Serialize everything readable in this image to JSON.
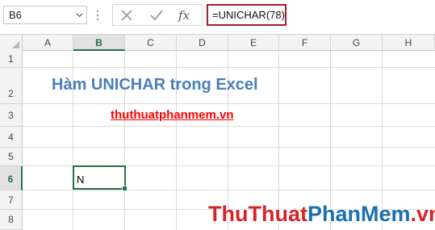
{
  "formula_bar": {
    "name_box_value": "B6",
    "formula_value": "=UNICHAR(78)"
  },
  "columns": [
    "A",
    "B",
    "C",
    "D",
    "E",
    "F",
    "G",
    "H"
  ],
  "rows": [
    "1",
    "2",
    "3",
    "4",
    "5",
    "6",
    "7",
    "8"
  ],
  "active_cell": {
    "column": "B",
    "row": "6"
  },
  "cells": {
    "title": "Hàm UNICHAR trong Excel",
    "link": "thuthuatphanmem.vn",
    "b6": "N"
  },
  "watermark": {
    "part1": "ThuThuat",
    "part2": "PhanMem",
    "part3": ".vn"
  },
  "colors": {
    "accent_green": "#217346",
    "title_blue": "#4a7ebb",
    "link_red": "#ff0000",
    "formula_highlight": "#a5202a"
  },
  "icons": [
    "dropdown-arrow-icon",
    "cancel-icon",
    "enter-icon",
    "insert-function-icon"
  ]
}
